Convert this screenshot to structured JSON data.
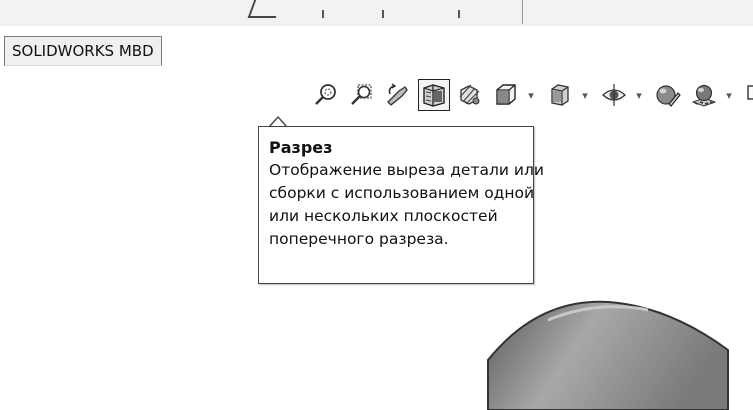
{
  "window": {
    "tab_label": "SOLIDWORKS MBD"
  },
  "toolbar": {
    "buttons": [
      {
        "icon": "zoom-to-fit-icon",
        "active": false,
        "has_dropdown": false
      },
      {
        "icon": "zoom-to-area-icon",
        "active": false,
        "has_dropdown": false
      },
      {
        "icon": "previous-view-icon",
        "active": false,
        "has_dropdown": false
      },
      {
        "icon": "section-view-icon",
        "active": true,
        "has_dropdown": false
      },
      {
        "icon": "dynamic-annotation-views-icon",
        "active": false,
        "has_dropdown": false
      },
      {
        "icon": "view-orientation-icon",
        "active": false,
        "has_dropdown": true
      },
      {
        "icon": "display-style-icon",
        "active": false,
        "has_dropdown": true
      },
      {
        "icon": "hide-show-items-icon",
        "active": false,
        "has_dropdown": true
      },
      {
        "icon": "edit-appearance-icon",
        "active": false,
        "has_dropdown": false
      },
      {
        "icon": "apply-scene-icon",
        "active": false,
        "has_dropdown": true
      },
      {
        "icon": "view-settings-icon",
        "active": false,
        "has_dropdown": true
      }
    ],
    "dropdown_glyph": "▾"
  },
  "tooltip": {
    "title": "Разрез",
    "lines": [
      "Отображение выреза детали или",
      "сборки с использованием одной",
      "или нескольких плоскостей",
      "поперечного разреза."
    ]
  },
  "colors": {
    "tooltip_border": "#444444",
    "background": "#ffffff",
    "model_fill": "#9a9a9a"
  }
}
